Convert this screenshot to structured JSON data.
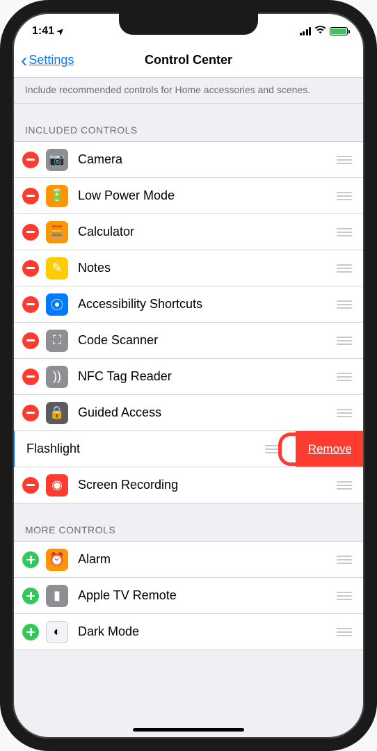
{
  "status": {
    "time": "1:41",
    "locationArrow": "➤"
  },
  "nav": {
    "back": "Settings",
    "title": "Control Center"
  },
  "description": "Include recommended controls for Home accessories and scenes.",
  "sections": {
    "included": {
      "header": "INCLUDED CONTROLS"
    },
    "more": {
      "header": "MORE CONTROLS"
    }
  },
  "included": [
    {
      "label": "Camera",
      "icon": "camera",
      "iconClass": "ic-camera",
      "glyph": "📷",
      "action": "remove"
    },
    {
      "label": "Low Power Mode",
      "icon": "lowpower",
      "iconClass": "ic-lowpower",
      "glyph": "🔋",
      "action": "remove"
    },
    {
      "label": "Calculator",
      "icon": "calculator",
      "iconClass": "ic-calculator",
      "glyph": "🧮",
      "action": "remove"
    },
    {
      "label": "Notes",
      "icon": "notes",
      "iconClass": "ic-notes",
      "glyph": "✎",
      "action": "remove"
    },
    {
      "label": "Accessibility Shortcuts",
      "icon": "accessibility",
      "iconClass": "ic-accessibility",
      "glyph": "⦿",
      "action": "remove"
    },
    {
      "label": "Code Scanner",
      "icon": "codescanner",
      "iconClass": "ic-codescanner",
      "glyph": "⛶",
      "action": "remove"
    },
    {
      "label": "NFC Tag Reader",
      "icon": "nfc",
      "iconClass": "ic-nfc",
      "glyph": "))",
      "action": "remove"
    },
    {
      "label": "Guided Access",
      "icon": "guided",
      "iconClass": "ic-guided",
      "glyph": "🔒",
      "action": "remove"
    },
    {
      "label": "Flashlight",
      "icon": "flashlight",
      "iconClass": "",
      "glyph": "",
      "action": "swiped",
      "removeLabel": "Remove"
    },
    {
      "label": "Screen Recording",
      "icon": "screenrec",
      "iconClass": "ic-screenrec",
      "glyph": "◉",
      "action": "remove"
    }
  ],
  "more": [
    {
      "label": "Alarm",
      "icon": "alarm",
      "iconClass": "ic-alarm",
      "glyph": "⏰",
      "action": "add"
    },
    {
      "label": "Apple TV Remote",
      "icon": "appletv",
      "iconClass": "ic-appletv",
      "glyph": "▮",
      "action": "add"
    },
    {
      "label": "Dark Mode",
      "icon": "darkmode",
      "iconClass": "ic-darkmode",
      "glyph": "◐",
      "action": "add"
    }
  ]
}
